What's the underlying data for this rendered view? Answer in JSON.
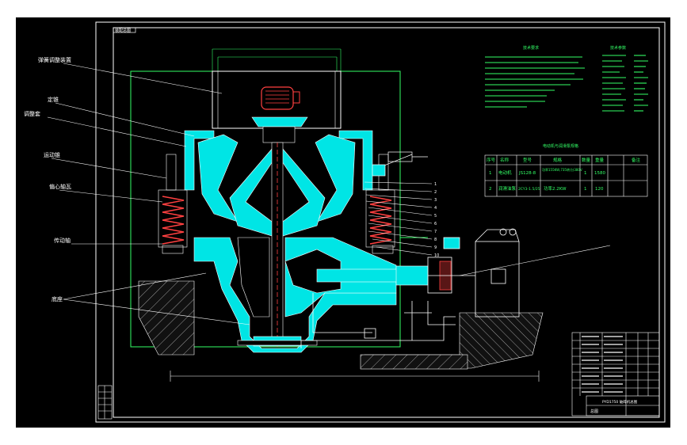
{
  "drawing": {
    "top_left_tag": "装配总图",
    "bottom_title": "PYD1750 破碎机总图",
    "title_block_code": "总图"
  },
  "callouts_left": [
    "弹簧调整装置",
    "定锥",
    "调整套",
    "运动锥",
    "偏心轴瓦",
    "传动轴",
    "底座"
  ],
  "notes_title": "技术要求",
  "params_title": "技术参数",
  "part_numbers": [
    "1",
    "2",
    "3",
    "4",
    "5",
    "6",
    "7",
    "8",
    "9",
    "10"
  ],
  "motor_table": {
    "title": "电动机与润滑泵规格",
    "headers": [
      "序号",
      "名称",
      "型号",
      "规格",
      "数量",
      "重量",
      "备注"
    ],
    "rows": [
      {
        "no": "1",
        "name": "电动机",
        "model": "JS128-8",
        "spec": "功率155KW,735转/分380V",
        "qty": "1",
        "weight": "1580",
        "note": ""
      },
      {
        "no": "2",
        "name": "润滑油泵",
        "model": "2CY3-1.5/25",
        "spec": "功率2.2KW",
        "qty": "1",
        "weight": "120",
        "note": ""
      }
    ]
  },
  "colors": {
    "background": "#000000",
    "frame": "#ffffff",
    "part_fill": "#00e5e5",
    "spring": "#ff4040",
    "hatch": "#aaaaaa",
    "tech_text": "#33ff66",
    "leader": "#ffffff"
  }
}
